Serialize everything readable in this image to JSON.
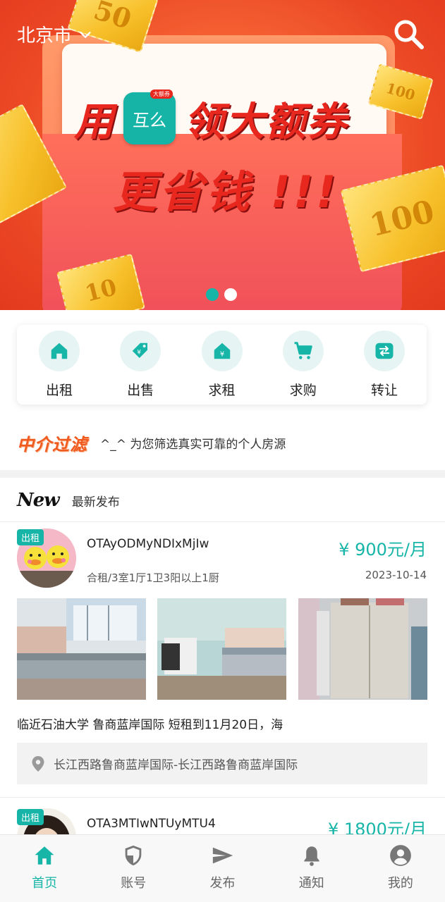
{
  "header": {
    "city": "北京市",
    "banner": {
      "line1_left": "用",
      "app_name": "互么",
      "app_tag": "大额券",
      "line1_right": "领大额券",
      "line2": "更省钱 !!!",
      "ticket_values": [
        "50",
        "100",
        "100",
        "10"
      ],
      "page_count": 2,
      "active_page": 1
    }
  },
  "categories": [
    {
      "label": "出租",
      "icon": "house-icon"
    },
    {
      "label": "出售",
      "icon": "price-tag-icon"
    },
    {
      "label": "求租",
      "icon": "yen-house-icon"
    },
    {
      "label": "求购",
      "icon": "cart-icon"
    },
    {
      "label": "转让",
      "icon": "transfer-icon"
    }
  ],
  "filter": {
    "logo": "中介过滤",
    "text": "^_^  为您筛选真实可靠的个人房源"
  },
  "latest": {
    "logo": "New",
    "title": "最新发布"
  },
  "listings": [
    {
      "badge": "出租",
      "name": "OTAyODMyNDIxMjIw",
      "price": "¥ 900元/月",
      "type": "合租/3室1厅1卫3阳以上1厨",
      "date": "2023-10-14",
      "description": "临近石油大学 鲁商蓝岸国际 短租到11月20日，海",
      "address": "长江西路鲁商蓝岸国际-长江西路鲁商蓝岸国际"
    },
    {
      "badge": "出租",
      "name": "OTA3MTIwNTUyMTU4",
      "price": "¥ 1800元/月"
    }
  ],
  "tabbar": [
    {
      "label": "首页",
      "icon": "home-icon",
      "active": true
    },
    {
      "label": "账号",
      "icon": "shield-icon",
      "active": false
    },
    {
      "label": "发布",
      "icon": "send-icon",
      "active": false
    },
    {
      "label": "通知",
      "icon": "bell-icon",
      "active": false
    },
    {
      "label": "我的",
      "icon": "account-circle-icon",
      "active": false
    }
  ],
  "colors": {
    "accent": "#17b5a8",
    "banner_red": "#e8281e",
    "filter_orange": "#f05a1e"
  }
}
